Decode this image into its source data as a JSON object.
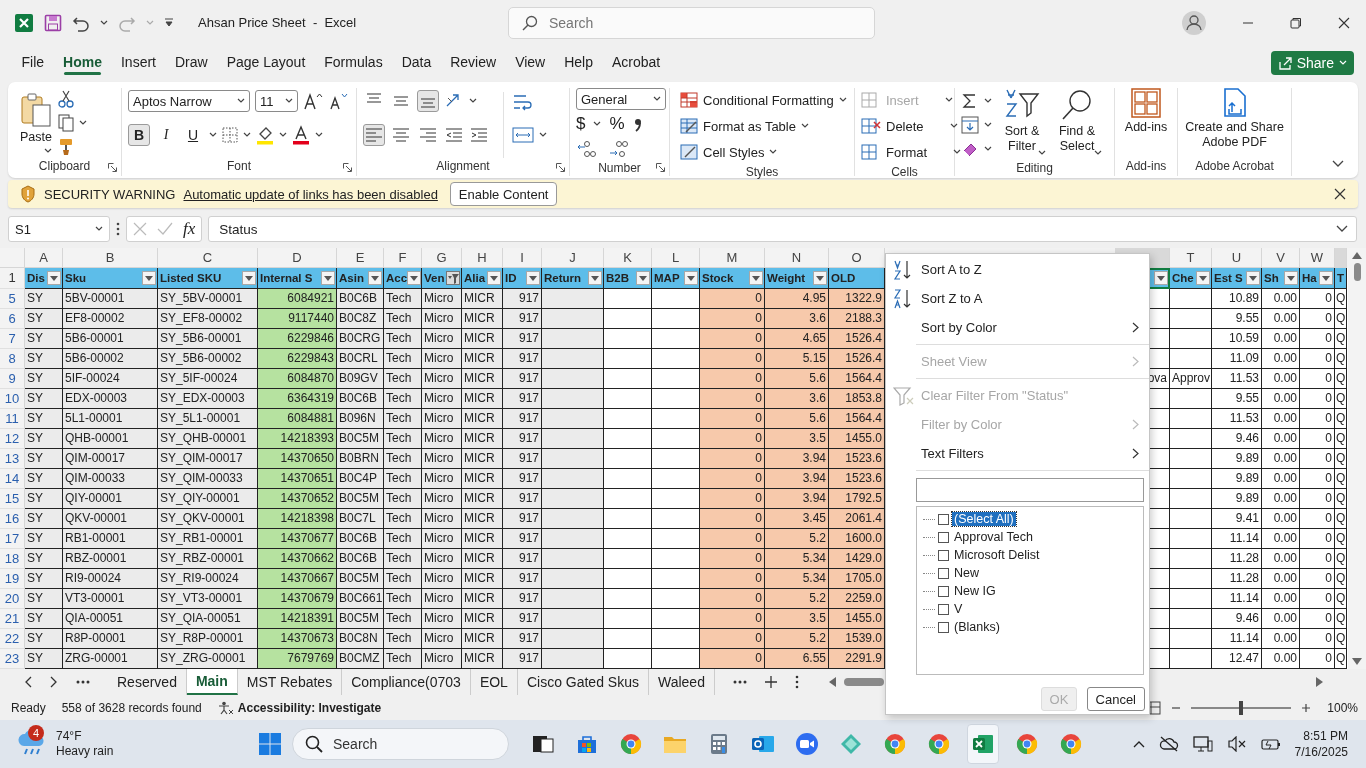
{
  "titlebar": {
    "title": "Ahsan Price Sheet  -  Excel",
    "search_placeholder": "Search"
  },
  "tabs": [
    {
      "label": "File",
      "selected": false
    },
    {
      "label": "Home",
      "selected": true
    },
    {
      "label": "Insert",
      "selected": false
    },
    {
      "label": "Draw",
      "selected": false
    },
    {
      "label": "Page Layout",
      "selected": false
    },
    {
      "label": "Formulas",
      "selected": false
    },
    {
      "label": "Data",
      "selected": false
    },
    {
      "label": "Review",
      "selected": false
    },
    {
      "label": "View",
      "selected": false
    },
    {
      "label": "Help",
      "selected": false
    },
    {
      "label": "Acrobat",
      "selected": false
    }
  ],
  "share": {
    "label": "Share"
  },
  "ribbon": {
    "groups": [
      {
        "kind": "clipboard",
        "label": "Clipboard",
        "paste": "Paste"
      },
      {
        "kind": "font",
        "label": "Font",
        "font_name": "Aptos Narrow",
        "font_size": "11",
        "buttons": [
          {
            "label": "B",
            "selected": true
          },
          {
            "label": "I",
            "selected": false
          },
          {
            "label": "U",
            "selected": false
          }
        ]
      },
      {
        "kind": "alignment",
        "label": "Alignment",
        "vertical_align": [
          {
            "selected": false
          },
          {
            "selected": false
          },
          {
            "selected": true
          }
        ],
        "horizontal_align": [
          {
            "selected": true
          },
          {
            "selected": false
          },
          {
            "selected": false
          }
        ]
      },
      {
        "kind": "number",
        "label": "Number",
        "format": "General",
        "symbols": [
          "$",
          "%"
        ]
      },
      {
        "kind": "styles",
        "label": "Styles",
        "items": [
          "Conditional Formatting",
          "Format as Table",
          "Cell Styles"
        ]
      },
      {
        "kind": "cells",
        "label": "Cells",
        "items": [
          {
            "label": "Insert",
            "disabled": true
          },
          {
            "label": "Delete",
            "disabled": false
          },
          {
            "label": "Format",
            "disabled": false
          }
        ]
      },
      {
        "kind": "editing",
        "label": "Editing",
        "items": [
          "Sort & Filter",
          "Find & Select"
        ]
      },
      {
        "kind": "addins",
        "label": "Add-ins",
        "button": "Add-ins"
      },
      {
        "kind": "acrobat",
        "label": "Adobe Acrobat",
        "button": "Create and Share Adobe PDF"
      }
    ]
  },
  "warning": {
    "title": "SECURITY WARNING",
    "message": "Automatic update of links has been disabled",
    "button": "Enable Content"
  },
  "formula_bar": {
    "name_box": "S1",
    "fx": "fx",
    "value": "Status"
  },
  "grid": {
    "header_row": "1",
    "columns": [
      {
        "letter": "A",
        "header": "Dis",
        "color": "#ebebeb",
        "kind": "text",
        "dropdown": true,
        "filtered": false
      },
      {
        "letter": "B",
        "header": "Sku",
        "color": "#ebebeb",
        "kind": "text",
        "dropdown": true,
        "filtered": false
      },
      {
        "letter": "C",
        "header": "Listed SKU",
        "color": "#ebebeb",
        "kind": "text",
        "dropdown": true,
        "filtered": false
      },
      {
        "letter": "D",
        "header": "Internal S",
        "color": "#b6e2a0",
        "kind": "number",
        "dropdown": true,
        "filtered": false
      },
      {
        "letter": "E",
        "header": "Asin",
        "color": "#ebebeb",
        "kind": "text",
        "dropdown": true,
        "filtered": false
      },
      {
        "letter": "F",
        "header": "Acc",
        "color": "#ebebeb",
        "kind": "text",
        "dropdown": true,
        "filtered": false
      },
      {
        "letter": "G",
        "header": "Ven",
        "color": "#ebebeb",
        "kind": "text",
        "dropdown": true,
        "filtered": true
      },
      {
        "letter": "H",
        "header": "Alia",
        "color": "#ebebeb",
        "kind": "text",
        "dropdown": true,
        "filtered": false
      },
      {
        "letter": "I",
        "header": "ID",
        "color": "#ebebeb",
        "kind": "number",
        "dropdown": true,
        "filtered": false
      },
      {
        "letter": "J",
        "header": "Return",
        "color": "#ebebeb",
        "kind": "text",
        "dropdown": true,
        "filtered": false
      },
      {
        "letter": "K",
        "header": "B2B",
        "color": "#ffffff",
        "kind": "text",
        "dropdown": true,
        "filtered": false
      },
      {
        "letter": "L",
        "header": "MAP",
        "color": "#ffffff",
        "kind": "text",
        "dropdown": true,
        "filtered": false
      },
      {
        "letter": "M",
        "header": "Stock",
        "color": "#f7c9ab",
        "kind": "number",
        "dropdown": true,
        "filtered": false
      },
      {
        "letter": "N",
        "header": "Weight",
        "color": "#f7c9ab",
        "kind": "number",
        "dropdown": true,
        "filtered": false
      },
      {
        "letter": "O",
        "header": "OLD",
        "color": "#f7c9ab",
        "kind": "number",
        "dropdown": false
      },
      {
        "color": "#ffffff",
        "kind": "overflow",
        "dropdown": true,
        "filtered": false
      },
      {
        "letter": "T",
        "header": "Che",
        "color": "#ffffff",
        "kind": "text",
        "dropdown": true,
        "filtered": false
      },
      {
        "letter": "U",
        "header": "Est S",
        "color": "#ffffff",
        "kind": "number",
        "dropdown": true,
        "filtered": false
      },
      {
        "letter": "V",
        "header": "Sh",
        "color": "#ffffff",
        "kind": "number",
        "dropdown": true,
        "filtered": false
      },
      {
        "letter": "W",
        "header": "Ha",
        "color": "#ffffff",
        "kind": "number",
        "dropdown": true,
        "filtered": false
      },
      {
        "header": "T",
        "color": "#ffffff",
        "kind": "text",
        "dropdown": false
      }
    ],
    "rows": [
      {
        "number": "5",
        "cells": [
          "SY",
          "5BV-00001",
          "SY_5BV-00001",
          "6084921",
          "B0C6B",
          "Tech",
          "Micro",
          "MICR",
          "917",
          null,
          null,
          null,
          "0",
          "4.95",
          "1322.9",
          null,
          null,
          "10.89",
          "0.00",
          "0",
          "Q"
        ]
      },
      {
        "number": "6",
        "cells": [
          "SY",
          "EF8-00002",
          "SY_EF8-00002",
          "9117440",
          "B0C8Z",
          "Tech",
          "Micro",
          "MICR",
          "917",
          null,
          null,
          null,
          "0",
          "3.6",
          "2188.3",
          null,
          null,
          "9.55",
          "0.00",
          "0",
          "Q"
        ]
      },
      {
        "number": "7",
        "cells": [
          "SY",
          "5B6-00001",
          "SY_5B6-00001",
          "6229846",
          "B0CRG",
          "Tech",
          "Micro",
          "MICR",
          "917",
          null,
          null,
          null,
          "0",
          "4.65",
          "1526.4",
          null,
          null,
          "10.59",
          "0.00",
          "0",
          "Q"
        ]
      },
      {
        "number": "8",
        "cells": [
          "SY",
          "5B6-00002",
          "SY_5B6-00002",
          "6229843",
          "B0CRL",
          "Tech",
          "Micro",
          "MICR",
          "917",
          null,
          null,
          null,
          "0",
          "5.15",
          "1526.4",
          null,
          null,
          "11.09",
          "0.00",
          "0",
          "Q"
        ]
      },
      {
        "number": "9",
        "cells": [
          "SY",
          "5IF-00024",
          "SY_5IF-00024",
          "6084870",
          "B09GV",
          "Tech",
          "Micro",
          "MICR",
          "917",
          null,
          null,
          null,
          "0",
          "5.6",
          "1564.4",
          "ova",
          "Approv",
          "11.53",
          "0.00",
          "0",
          "Q"
        ]
      },
      {
        "number": "10",
        "cells": [
          "SY",
          "EDX-00003",
          "SY_EDX-00003",
          "6364319",
          "B0C6B",
          "Tech",
          "Micro",
          "MICR",
          "917",
          null,
          null,
          null,
          "0",
          "3.6",
          "1853.8",
          null,
          null,
          "9.55",
          "0.00",
          "0",
          "Q"
        ]
      },
      {
        "number": "11",
        "cells": [
          "SY",
          "5L1-00001",
          "SY_5L1-00001",
          "6084881",
          "B096N",
          "Tech",
          "Micro",
          "MICR",
          "917",
          null,
          null,
          null,
          "0",
          "5.6",
          "1564.4",
          null,
          null,
          "11.53",
          "0.00",
          "0",
          "Q"
        ]
      },
      {
        "number": "12",
        "cells": [
          "SY",
          "QHB-00001",
          "SY_QHB-00001",
          "14218393",
          "B0C5M",
          "Tech",
          "Micro",
          "MICR",
          "917",
          null,
          null,
          null,
          "0",
          "3.5",
          "1455.0",
          null,
          null,
          "9.46",
          "0.00",
          "0",
          "Q"
        ]
      },
      {
        "number": "13",
        "cells": [
          "SY",
          "QIM-00017",
          "SY_QIM-00017",
          "14370650",
          "B0BRN",
          "Tech",
          "Micro",
          "MICR",
          "917",
          null,
          null,
          null,
          "0",
          "3.94",
          "1523.6",
          null,
          null,
          "9.89",
          "0.00",
          "0",
          "Q"
        ]
      },
      {
        "number": "14",
        "cells": [
          "SY",
          "QIM-00033",
          "SY_QIM-00033",
          "14370651",
          "B0C4P",
          "Tech",
          "Micro",
          "MICR",
          "917",
          null,
          null,
          null,
          "0",
          "3.94",
          "1523.6",
          null,
          null,
          "9.89",
          "0.00",
          "0",
          "Q"
        ]
      },
      {
        "number": "15",
        "cells": [
          "SY",
          "QIY-00001",
          "SY_QIY-00001",
          "14370652",
          "B0C5M",
          "Tech",
          "Micro",
          "MICR",
          "917",
          null,
          null,
          null,
          "0",
          "3.94",
          "1792.5",
          null,
          null,
          "9.89",
          "0.00",
          "0",
          "Q"
        ]
      },
      {
        "number": "16",
        "cells": [
          "SY",
          "QKV-00001",
          "SY_QKV-00001",
          "14218398",
          "B0C7L",
          "Tech",
          "Micro",
          "MICR",
          "917",
          null,
          null,
          null,
          "0",
          "3.45",
          "2061.4",
          null,
          null,
          "9.41",
          "0.00",
          "0",
          "Q"
        ]
      },
      {
        "number": "17",
        "cells": [
          "SY",
          "RB1-00001",
          "SY_RB1-00001",
          "14370677",
          "B0C6B",
          "Tech",
          "Micro",
          "MICR",
          "917",
          null,
          null,
          null,
          "0",
          "5.2",
          "1600.0",
          null,
          null,
          "11.14",
          "0.00",
          "0",
          "Q"
        ]
      },
      {
        "number": "18",
        "cells": [
          "SY",
          "RBZ-00001",
          "SY_RBZ-00001",
          "14370662",
          "B0C6B",
          "Tech",
          "Micro",
          "MICR",
          "917",
          null,
          null,
          null,
          "0",
          "5.34",
          "1429.0",
          null,
          null,
          "11.28",
          "0.00",
          "0",
          "Q"
        ]
      },
      {
        "number": "19",
        "cells": [
          "SY",
          "RI9-00024",
          "SY_RI9-00024",
          "14370667",
          "B0C5M",
          "Tech",
          "Micro",
          "MICR",
          "917",
          null,
          null,
          null,
          "0",
          "5.34",
          "1705.0",
          null,
          null,
          "11.28",
          "0.00",
          "0",
          "Q"
        ]
      },
      {
        "number": "20",
        "cells": [
          "SY",
          "VT3-00001",
          "SY_VT3-00001",
          "14370679",
          "B0C661",
          "Tech",
          "Micro",
          "MICR",
          "917",
          null,
          null,
          null,
          "0",
          "5.2",
          "2259.0",
          null,
          null,
          "11.14",
          "0.00",
          "0",
          "Q"
        ]
      },
      {
        "number": "21",
        "cells": [
          "SY",
          "QIA-00051",
          "SY_QIA-00051",
          "14218391",
          "B0C5M",
          "Tech",
          "Micro",
          "MICR",
          "917",
          null,
          null,
          null,
          "0",
          "3.5",
          "1455.0",
          null,
          null,
          "9.46",
          "0.00",
          "0",
          "Q"
        ]
      },
      {
        "number": "22",
        "cells": [
          "SY",
          "R8P-00001",
          "SY_R8P-00001",
          "14370673",
          "B0C8N",
          "Tech",
          "Micro",
          "MICR",
          "917",
          null,
          null,
          null,
          "0",
          "5.2",
          "1539.0",
          null,
          null,
          "11.14",
          "0.00",
          "0",
          "Q"
        ]
      },
      {
        "number": "23",
        "cells": [
          "SY",
          "ZRG-00001",
          "SY_ZRG-00001",
          "7679769",
          "B0CMZ",
          "Tech",
          "Micro",
          "MICR",
          "917",
          null,
          null,
          null,
          "0",
          "6.55",
          "2291.9",
          null,
          null,
          "12.47",
          "0.00",
          "0",
          "Q"
        ]
      }
    ]
  },
  "sheet_tabs": [
    {
      "label": "Reserved",
      "selected": false
    },
    {
      "label": "Main",
      "selected": true
    },
    {
      "label": "MST Rebates",
      "selected": false
    },
    {
      "label": "Compliance(0703",
      "selected": false
    },
    {
      "label": "EOL",
      "selected": false
    },
    {
      "label": "Cisco Gated Skus",
      "selected": false
    },
    {
      "label": "Waleed",
      "selected": false
    }
  ],
  "status_bar": {
    "mode": "Ready",
    "records": "558 of 3628 records found",
    "accessibility": "Accessibility: Investigate",
    "zoom": "100%",
    "zoom_slider": {
      "level": 0.5
    }
  },
  "filter_menu": {
    "items": [
      {
        "kind": "sort_asc",
        "label": "Sort A to Z",
        "disabled": false,
        "submenu": false
      },
      {
        "kind": "sort_desc",
        "label": "Sort Z to A",
        "disabled": false,
        "submenu": false
      },
      {
        "kind": "command",
        "label": "Sort by Color",
        "disabled": false,
        "submenu": true
      },
      {
        "kind": "separator"
      },
      {
        "kind": "command",
        "label": "Sheet View",
        "disabled": true,
        "submenu": true
      },
      {
        "kind": "separator"
      },
      {
        "kind": "clear",
        "label": "Clear Filter From \"Status\"",
        "disabled": true,
        "submenu": false
      },
      {
        "kind": "command",
        "label": "Filter by Color",
        "disabled": true,
        "submenu": true
      },
      {
        "kind": "command",
        "label": "Text Filters",
        "disabled": false,
        "submenu": true
      },
      {
        "kind": "separator"
      }
    ],
    "values": [
      {
        "label": "(Select All)",
        "checked": false,
        "selected": true
      },
      {
        "label": "Approval Tech",
        "checked": false,
        "selected": false
      },
      {
        "label": "Microsoft Delist",
        "checked": false,
        "selected": false
      },
      {
        "label": "New",
        "checked": false,
        "selected": false
      },
      {
        "label": "New IG",
        "checked": false,
        "selected": false
      },
      {
        "label": "V",
        "checked": false,
        "selected": false
      },
      {
        "label": "(Blanks)",
        "checked": false,
        "selected": false
      }
    ],
    "buttons": [
      {
        "label": "OK",
        "disabled": true
      },
      {
        "label": "Cancel",
        "disabled": false
      }
    ]
  },
  "taskbar": {
    "weather": {
      "badge": "4",
      "temp": "74°F",
      "condition": "Heavy rain"
    },
    "search_placeholder": "Search",
    "apps": [
      {
        "kind": "taskview",
        "selected": false
      },
      {
        "kind": "store",
        "selected": false
      },
      {
        "kind": "chrome",
        "selected": false
      },
      {
        "kind": "folder",
        "selected": false
      },
      {
        "kind": "calculator",
        "selected": false
      },
      {
        "kind": "outlook",
        "selected": false
      },
      {
        "kind": "zoom",
        "selected": false
      },
      {
        "kind": "diamond",
        "selected": false
      },
      {
        "kind": "chrome",
        "selected": false
      },
      {
        "kind": "chrome",
        "selected": false
      },
      {
        "kind": "excel",
        "selected": true
      },
      {
        "kind": "chrome",
        "selected": false
      },
      {
        "kind": "chrome",
        "selected": false
      }
    ],
    "clock": {
      "time": "8:51 PM",
      "date": "7/16/2025"
    }
  }
}
